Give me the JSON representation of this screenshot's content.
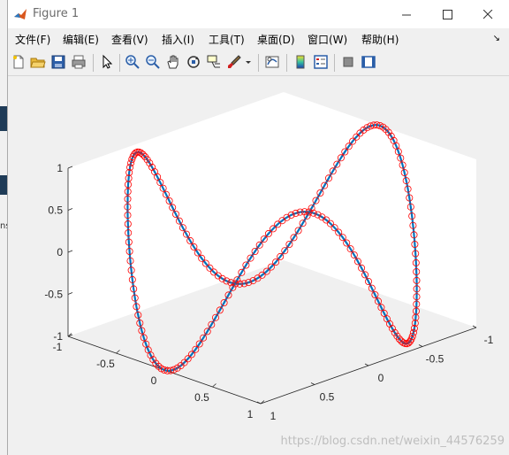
{
  "window": {
    "title": "Figure 1",
    "icons": {
      "app": "matlab-icon",
      "minimize": "minimize-icon",
      "maximize": "maximize-icon",
      "close": "close-icon"
    }
  },
  "menubar": {
    "items": [
      "文件(F)",
      "编辑(E)",
      "查看(V)",
      "插入(I)",
      "工具(T)",
      "桌面(D)",
      "窗口(W)",
      "帮助(H)"
    ],
    "overflow_icon": "dock-arrow-icon"
  },
  "toolbar": {
    "buttons": [
      "new-figure-icon",
      "open-file-icon",
      "save-icon",
      "print-icon",
      "select-pointer-icon",
      "zoom-in-icon",
      "zoom-out-icon",
      "pan-hand-icon",
      "rotate-3d-icon",
      "data-cursor-icon",
      "brush-icon",
      "brush-dropdown-icon",
      "link-plot-icon",
      "colorbar-icon",
      "legend-icon",
      "hide-plot-tools-icon",
      "show-plot-tools-icon"
    ]
  },
  "background_app": {
    "partial_text": "ns"
  },
  "watermark": "https://blog.csdn.net/weixin_44576259",
  "chart_data": {
    "type": "line",
    "dimensions": "3d",
    "title": "",
    "xlabel": "",
    "ylabel": "",
    "zlabel": "",
    "xlim": [
      -1,
      1
    ],
    "ylim": [
      -1,
      1
    ],
    "zlim": [
      -1,
      1
    ],
    "x_ticks": [
      "-1",
      "-0.5",
      "0",
      "0.5",
      "1"
    ],
    "y_ticks": [
      "-1",
      "-0.5",
      "0",
      "0.5",
      "1"
    ],
    "z_ticks": [
      "-1",
      "-0.5",
      "0",
      "0.5",
      "1"
    ],
    "grid": false,
    "legend": "none",
    "series": [
      {
        "style": "line",
        "color": "#0072bd",
        "x": [
          "cos(t)"
        ],
        "y": [
          "sin(t)"
        ],
        "z": [
          "sin(3t)"
        ],
        "t_range": [
          0,
          6.2832
        ]
      },
      {
        "style": "markers",
        "marker": "circle",
        "color": "#ff0000",
        "x": [
          "cos(t)"
        ],
        "y": [
          "sin(t)"
        ],
        "z": [
          "sin(3t)"
        ],
        "t_range": [
          0,
          6.2832
        ]
      }
    ],
    "sample_points": {
      "t": [
        0,
        0.524,
        1.047,
        1.571,
        2.094,
        2.618,
        3.142,
        3.665,
        4.189,
        4.712,
        5.236,
        5.76
      ],
      "x": [
        1,
        0.866,
        0.5,
        0,
        -0.5,
        -0.866,
        -1,
        -0.866,
        -0.5,
        0,
        0.5,
        0.866
      ],
      "y": [
        0,
        0.5,
        0.866,
        1,
        0.866,
        0.5,
        0,
        -0.5,
        -0.866,
        -1,
        -0.866,
        -0.5
      ],
      "z": [
        0,
        1,
        0,
        -1,
        0,
        1,
        0,
        -1,
        0,
        1,
        0,
        -1
      ]
    },
    "colors": {
      "line": "#0072bd",
      "markers": "#ff0000",
      "axes_bg": "#ffffff",
      "figure_bg": "#f0f0f0"
    }
  }
}
